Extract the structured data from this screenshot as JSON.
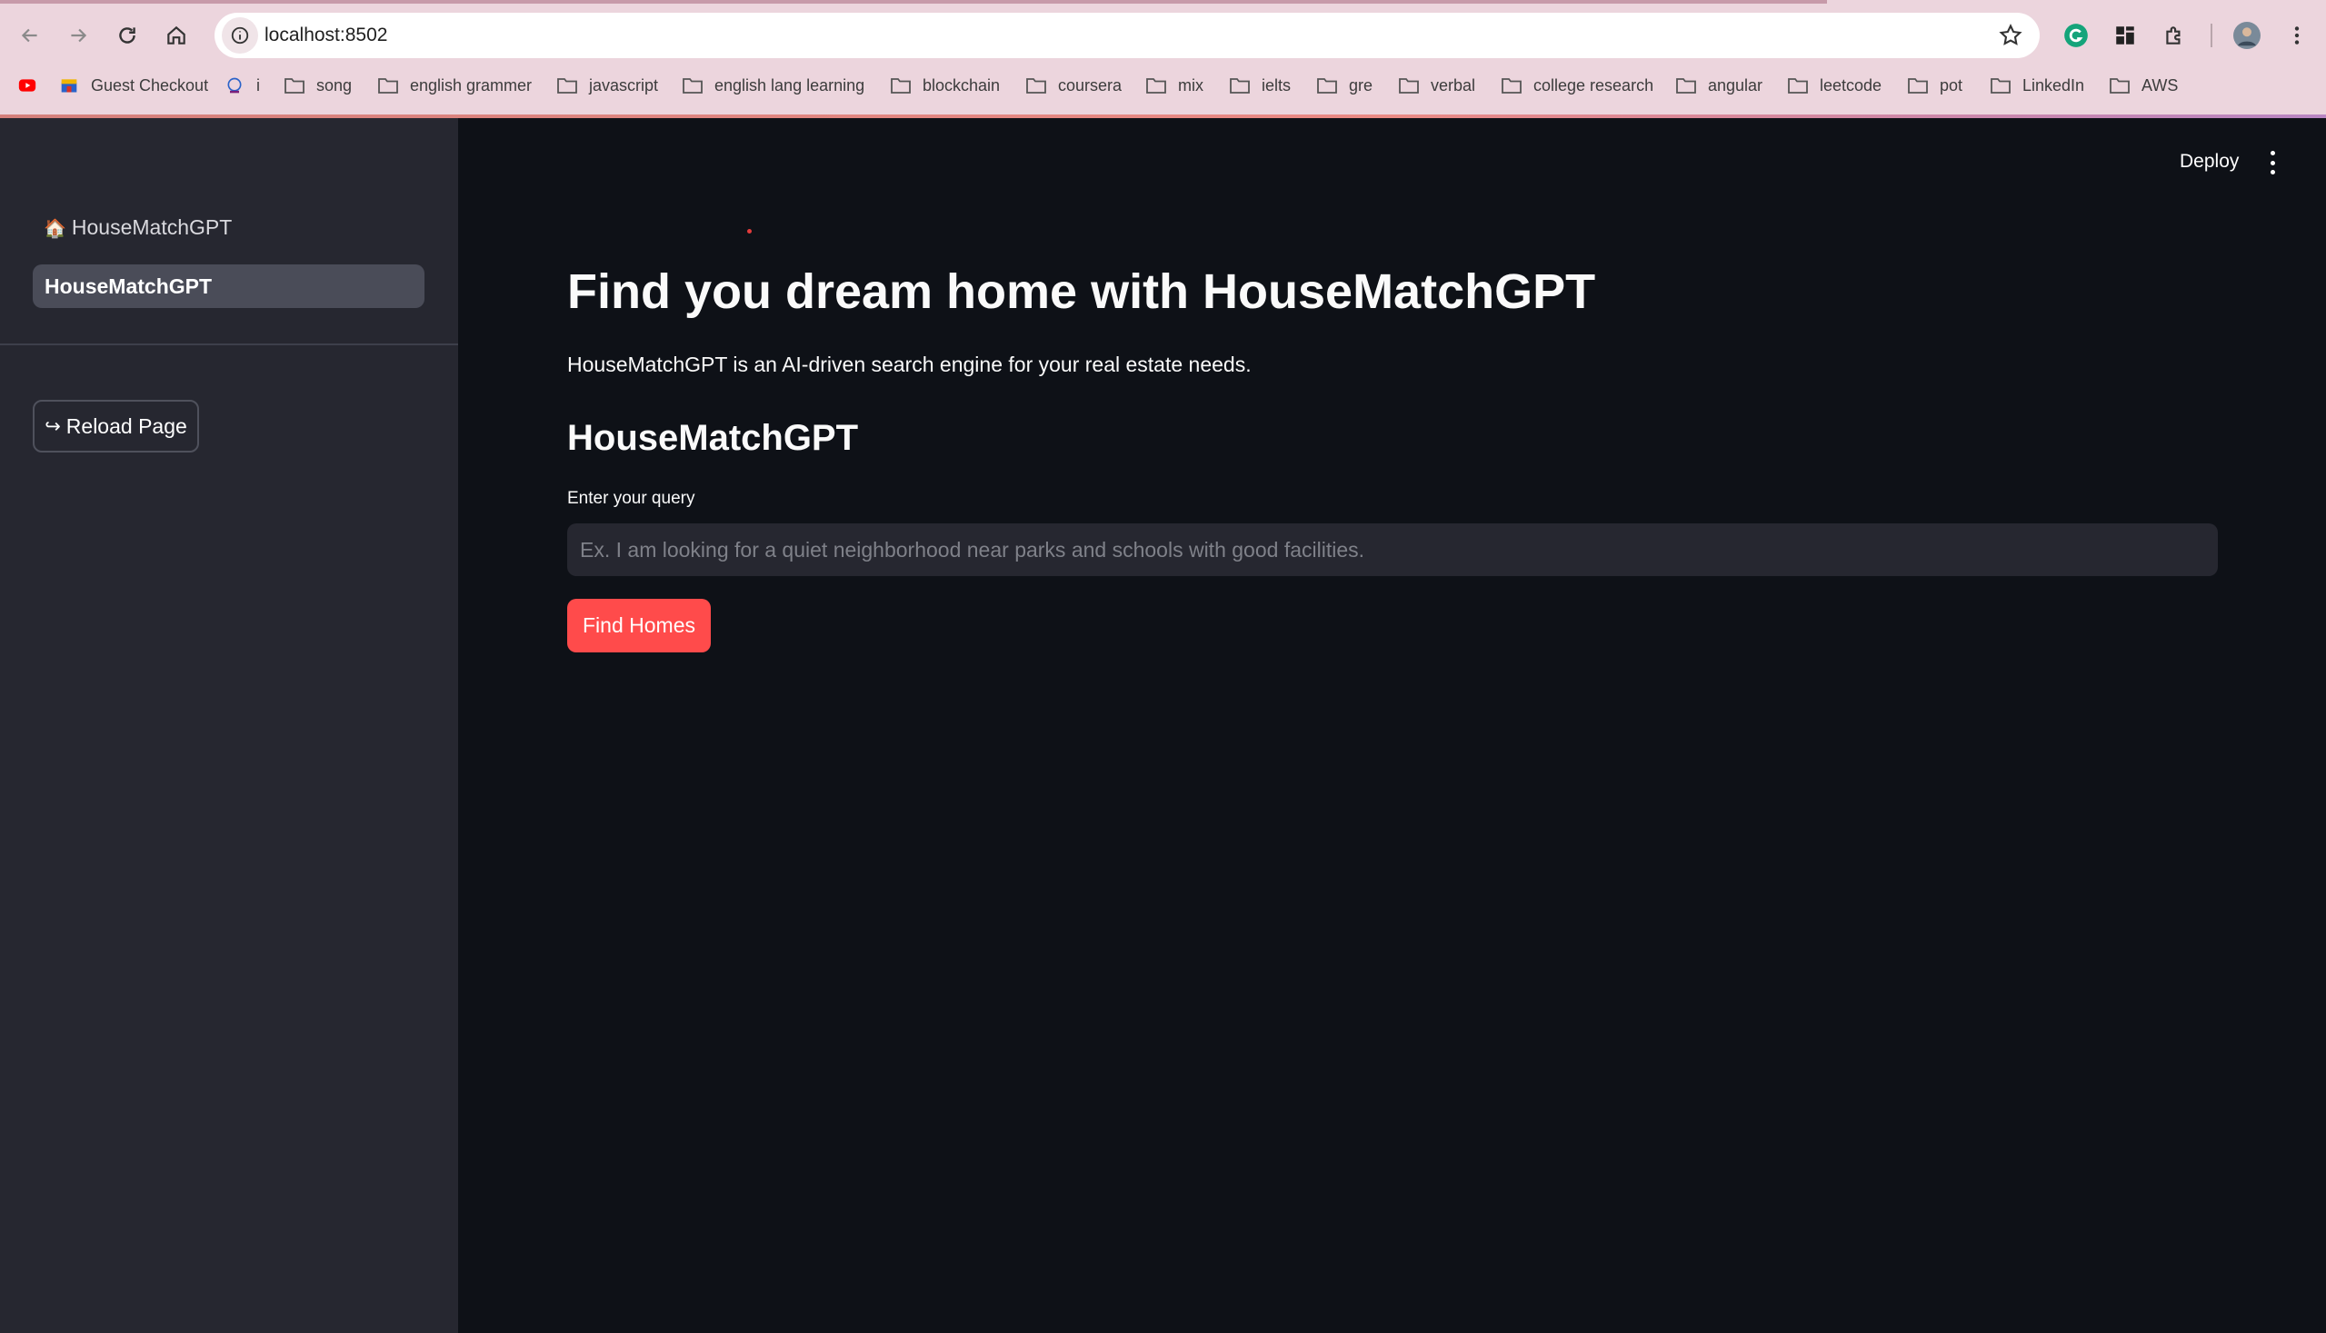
{
  "browser": {
    "url": "localhost:8502",
    "bookmarks": [
      {
        "label": "",
        "icon": "youtube-icon"
      },
      {
        "label": "Guest Checkout",
        "icon": "shop-icon"
      },
      {
        "label": "i",
        "icon": "site-icon"
      },
      {
        "label": "song",
        "icon": "folder-icon"
      },
      {
        "label": "english grammer",
        "icon": "folder-icon"
      },
      {
        "label": "javascript",
        "icon": "folder-icon"
      },
      {
        "label": "english lang learning",
        "icon": "folder-icon"
      },
      {
        "label": "blockchain",
        "icon": "folder-icon"
      },
      {
        "label": "coursera",
        "icon": "folder-icon"
      },
      {
        "label": "mix",
        "icon": "folder-icon"
      },
      {
        "label": "ielts",
        "icon": "folder-icon"
      },
      {
        "label": "gre",
        "icon": "folder-icon"
      },
      {
        "label": "verbal",
        "icon": "folder-icon"
      },
      {
        "label": "college research",
        "icon": "folder-icon"
      },
      {
        "label": "angular",
        "icon": "folder-icon"
      },
      {
        "label": "leetcode",
        "icon": "folder-icon"
      },
      {
        "label": "pot",
        "icon": "folder-icon"
      },
      {
        "label": "LinkedIn",
        "icon": "folder-icon"
      },
      {
        "label": "AWS",
        "icon": "folder-icon"
      }
    ]
  },
  "sidebar": {
    "app_title": "HouseMatchGPT",
    "app_icon": "house-icon",
    "active_page": "HouseMatchGPT",
    "reload_label": "Reload Page",
    "reload_icon": "↪"
  },
  "header": {
    "deploy_label": "Deploy"
  },
  "main": {
    "title": "Find you dream home with HouseMatchGPT",
    "description": "HouseMatchGPT is an AI-driven search engine for your real estate needs.",
    "section_title": "HouseMatchGPT",
    "query_label": "Enter your query",
    "query_placeholder": "Ex. I am looking for a quiet neighborhood near parks and schools with good facilities.",
    "query_value": "",
    "button_label": "Find Homes"
  },
  "colors": {
    "primary": "#ff4b4b",
    "background": "#0e1117",
    "sidebar": "#262730"
  }
}
